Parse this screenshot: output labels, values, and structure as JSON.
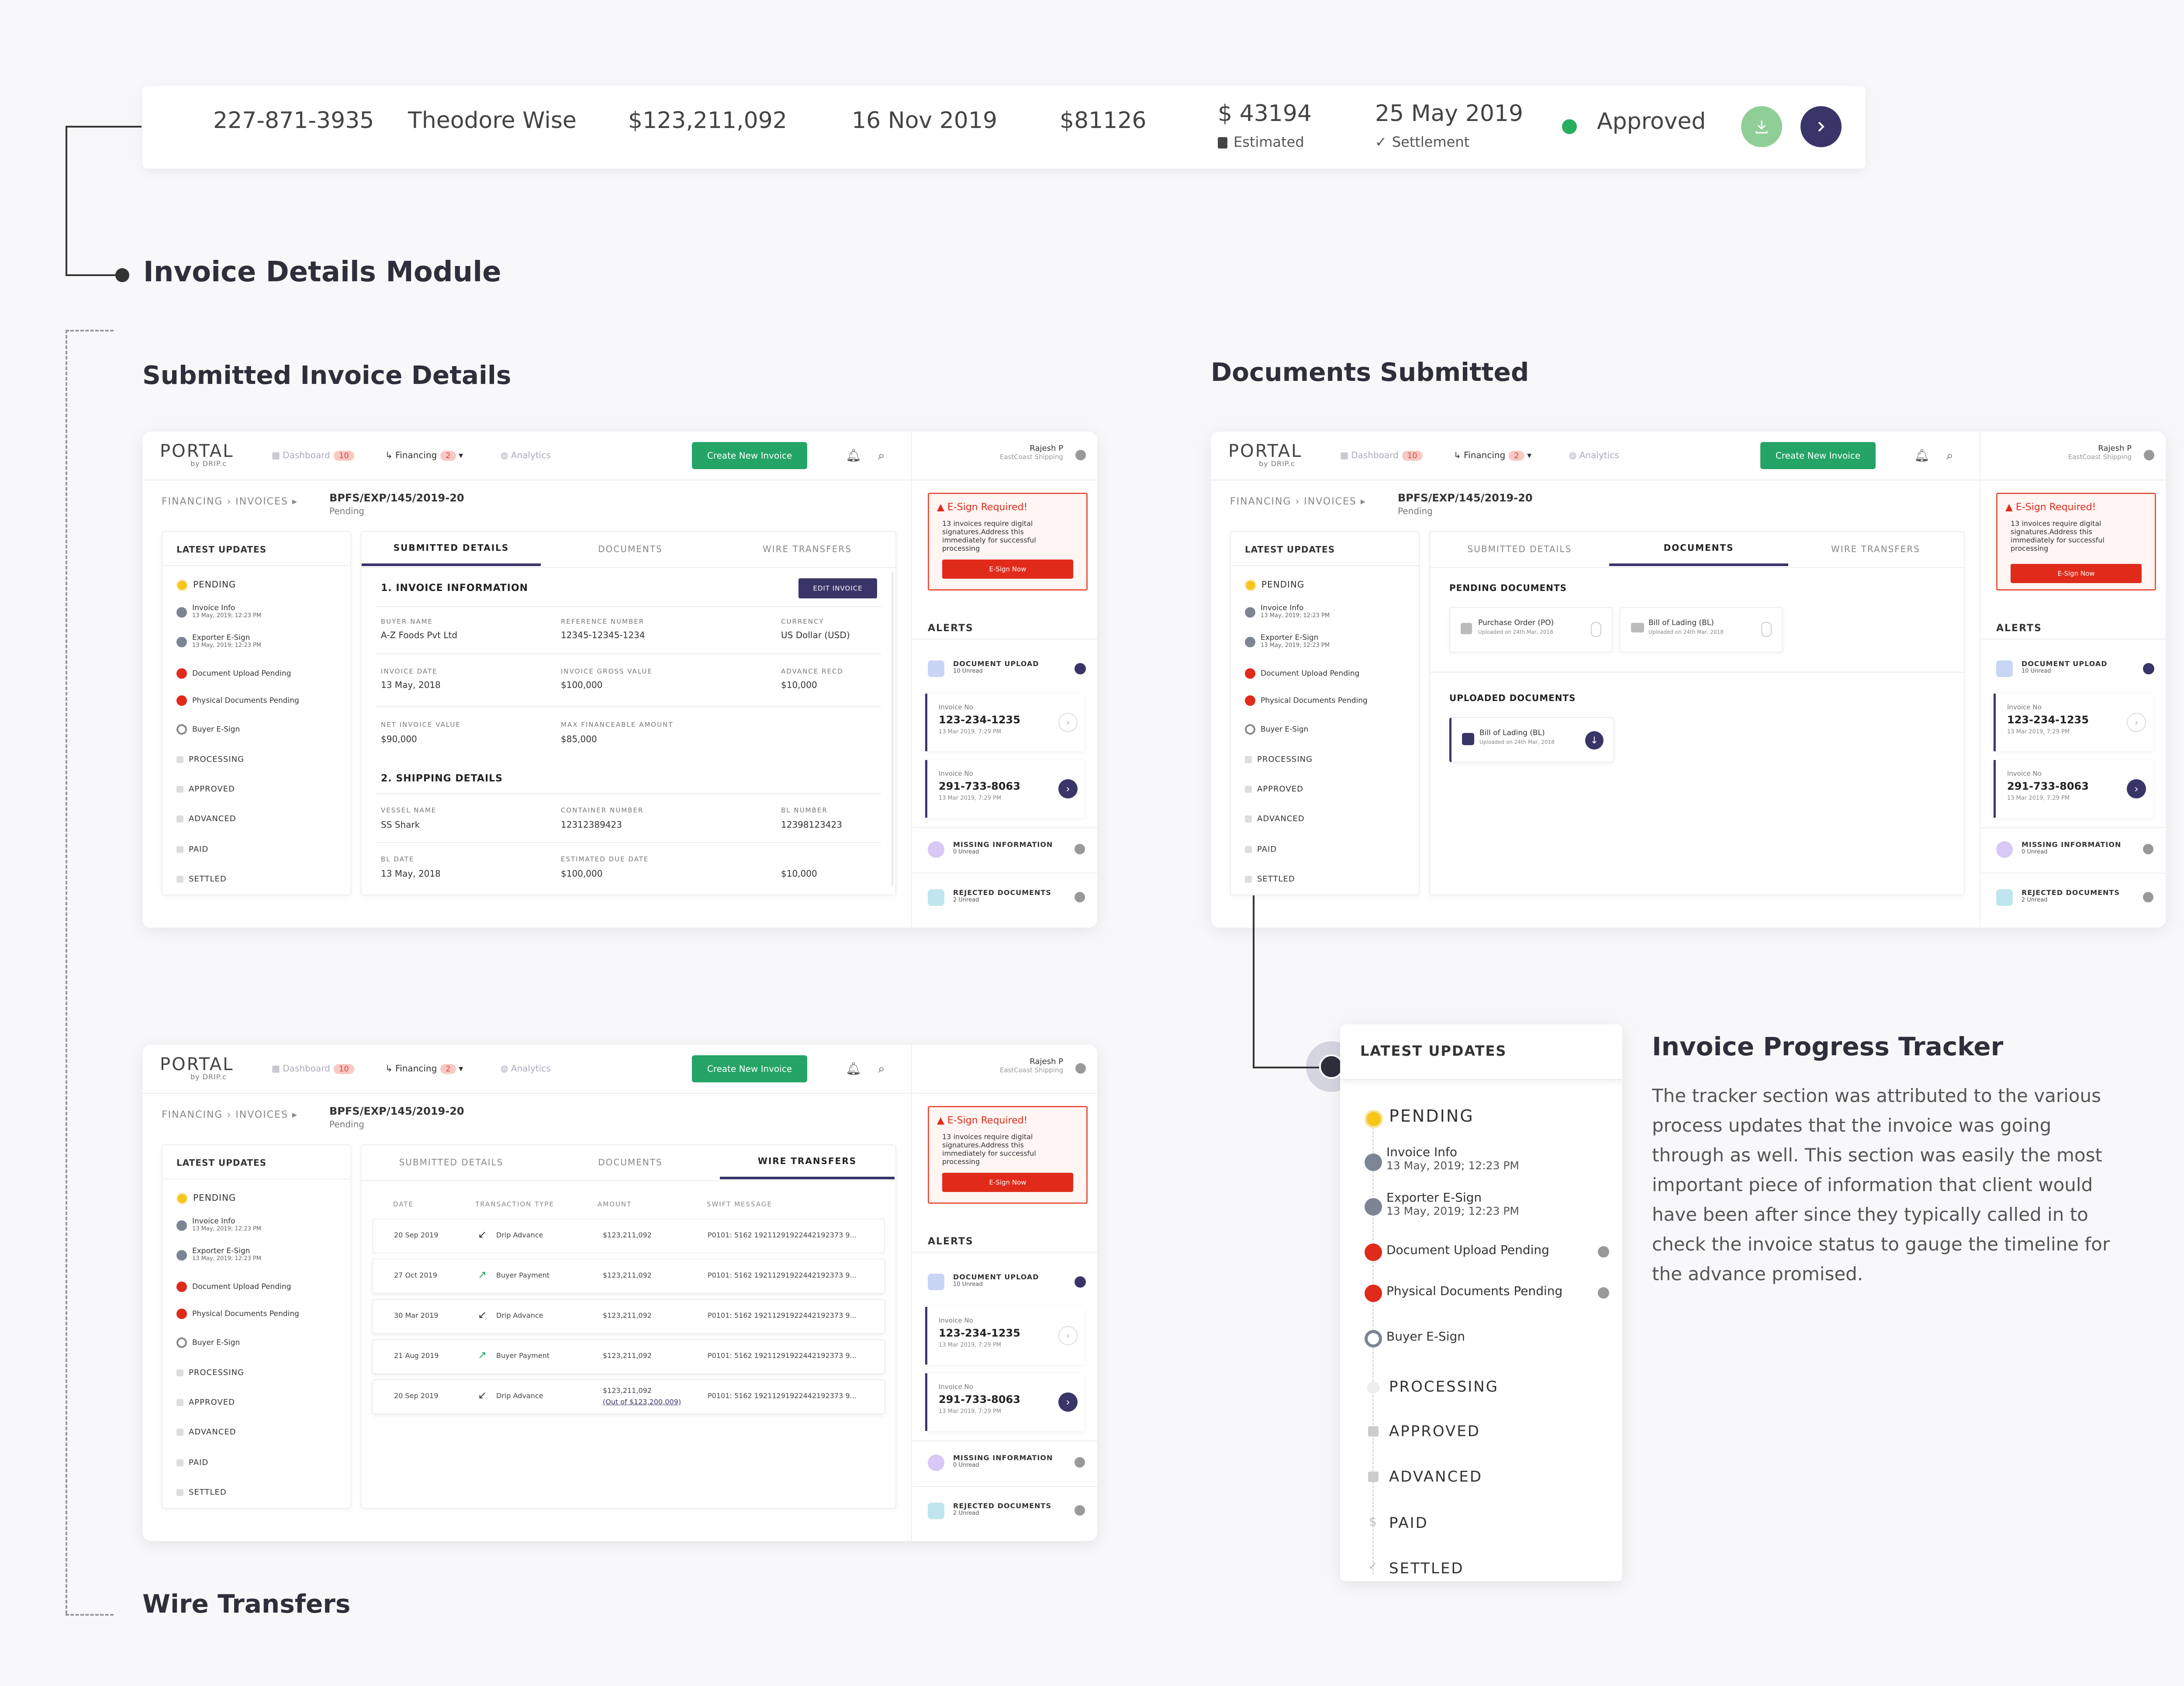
{
  "summary": {
    "phone": "227-871-3935",
    "name": "Theodore Wise",
    "amount": "$123,211,092",
    "date": "16 Nov 2019",
    "small_amount": "$81126",
    "estimated_amount": "$ 43194",
    "estimated_label": "Estimated",
    "settlement_date": "25 May 2019",
    "settlement_label": "Settlement",
    "status": "Approved",
    "colors": {
      "status": "#27ae60",
      "download": "#8fcf97",
      "next": "#3a3568"
    }
  },
  "module_title": "Invoice Details Module",
  "sections": {
    "submitted": "Submitted Invoice Details",
    "documents": "Documents Submitted",
    "wire": "Wire Transfers"
  },
  "app": {
    "logo": "PORTAL",
    "logo_sub": "by DRIP.c",
    "nav": {
      "dashboard": "Dashboard",
      "dashboard_count": "10",
      "financing": "Financing",
      "financing_count": "2",
      "analytics": "Analytics"
    },
    "create_button": "Create New Invoice",
    "user_name": "Rajesh P",
    "user_company": "EastCoast Shipping",
    "breadcrumb": {
      "financing": "FINANCING",
      "invoices": "INVOICES",
      "id": "BPFS/EXP/145/2019-20",
      "status": "Pending"
    },
    "tabs": {
      "submitted": "SUBMITTED DETAILS",
      "documents": "DOCUMENTS",
      "wire": "WIRE TRANSFERS"
    },
    "updates": {
      "title": "LATEST UPDATES",
      "pending": "PENDING",
      "invoice_info": "Invoice Info",
      "invoice_info_date": "13 May, 2019; 12:23 PM",
      "exporter": "Exporter E-Sign",
      "exporter_date": "13 May, 2019; 12:23 PM",
      "doc_upload": "Document Upload Pending",
      "phys_docs": "Physical Documents Pending",
      "buyer_esign": "Buyer E-Sign",
      "processing": "PROCESSING",
      "approved": "APPROVED",
      "advanced": "ADVANCED",
      "paid": "PAID",
      "settled": "SETTLED"
    },
    "esign": {
      "title": "E-Sign Required!",
      "desc": "13 invoices require digital signatures.Address this immediately for successful processing",
      "button": "E-Sign Now"
    },
    "alerts": {
      "title": "ALERTS",
      "doc_upload": "DOCUMENT UPLOAD",
      "doc_upload_sub": "10 Unread",
      "inv1_label": "Invoice No",
      "inv1_no": "123-234-1235",
      "inv1_date": "13 Mar 2019, 7:29 PM",
      "inv2_label": "Invoice No",
      "inv2_no": "291-733-8063",
      "inv2_date": "13 Mar 2019, 7:29 PM",
      "missing": "MISSING INFORMATION",
      "missing_sub": "0 Unread",
      "rejected": "REJECTED DOCUMENTS",
      "rejected_sub": "2 Unread"
    }
  },
  "invoice_details": {
    "section1": "1. INVOICE INFORMATION",
    "edit_button": "EDIT INVOICE",
    "buyer_name_label": "BUYER NAME",
    "buyer_name": "A-Z Foods Pvt Ltd",
    "ref_label": "REFERENCE NUMBER",
    "ref": "12345-12345-1234",
    "currency_label": "CURRENCY",
    "currency": "US Dollar (USD)",
    "inv_date_label": "INVOICE DATE",
    "inv_date": "13 May, 2018",
    "gross_label": "INVOICE GROSS VALUE",
    "gross": "$100,000",
    "adv_label": "ADVANCE RECD",
    "adv": "$10,000",
    "net_label": "NET INVOICE VALUE",
    "net": "$90,000",
    "max_label": "MAX FINANCEABLE AMOUNT",
    "max": "$85,000",
    "section2": "2. SHIPPING DETAILS",
    "vessel_label": "VESSEL NAME",
    "vessel": "SS Shark",
    "container_label": "CONTAINER NUMBER",
    "container": "12312389423",
    "bl_label": "BL NUMBER",
    "bl": "12398123423",
    "bl_date_label": "BL DATE",
    "bl_date": "13 May, 2018",
    "due_label": "ESTIMATED DUE DATE",
    "due": "$100,000",
    "last_value": "$10,000"
  },
  "documents": {
    "pending_title": "PENDING DOCUMENTS",
    "po": "Purchase Order (PO)",
    "po_sub": "Uploaded on 24th Mar, 2018",
    "bl": "Bill of Lading (BL)",
    "bl_sub": "Uploaded on 24th Mar, 2018",
    "uploaded_title": "UPLOADED DOCUMENTS",
    "up_bl": "Bill of Lading (BL)",
    "up_bl_sub": "Uploaded on 24th Mar, 2018"
  },
  "wire": {
    "headers": {
      "date": "DATE",
      "type": "TRANSACTION TYPE",
      "amount": "AMOUNT",
      "swift": "SWIFT MESSAGE"
    },
    "rows": [
      {
        "date": "20 Sep 2019",
        "type": "Drip Advance",
        "amount": "$123,211,092",
        "swift": "P0101: 5162 19211291922442192373 9..."
      },
      {
        "date": "27 Oct 2019",
        "type": "Buyer Payment",
        "amount": "$123,211,092",
        "swift": "P0101: 5162 19211291922442192373 9..."
      },
      {
        "date": "30 Mar 2019",
        "type": "Drip Advance",
        "amount": "$123,211,092",
        "swift": "P0101: 5162 19211291922442192373 9..."
      },
      {
        "date": "21 Aug 2019",
        "type": "Buyer Payment",
        "amount": "$123,211,092",
        "swift": "P0101: 5162 19211291922442192373 9..."
      },
      {
        "date": "20 Sep 2019",
        "type": "Drip Advance",
        "amount": "$123,211,092",
        "amount_note": "(Out of $123,200,009)",
        "swift": "P0101: 5162 19211291922442192373 9..."
      }
    ]
  },
  "tracker": {
    "title": "Invoice Progress Tracker",
    "description": "The tracker section was attributed to the various process updates that the invoice was going through as well. This section was easily the most important piece of information that client would have been after since they typically called in to check the invoice status to gauge the timeline for the advance promised."
  },
  "icons": {
    "calendar": "calendar-icon",
    "check": "check-icon",
    "download": "download-icon",
    "next": "chevron-right-icon",
    "bell": "bell-icon",
    "search": "search-icon"
  }
}
